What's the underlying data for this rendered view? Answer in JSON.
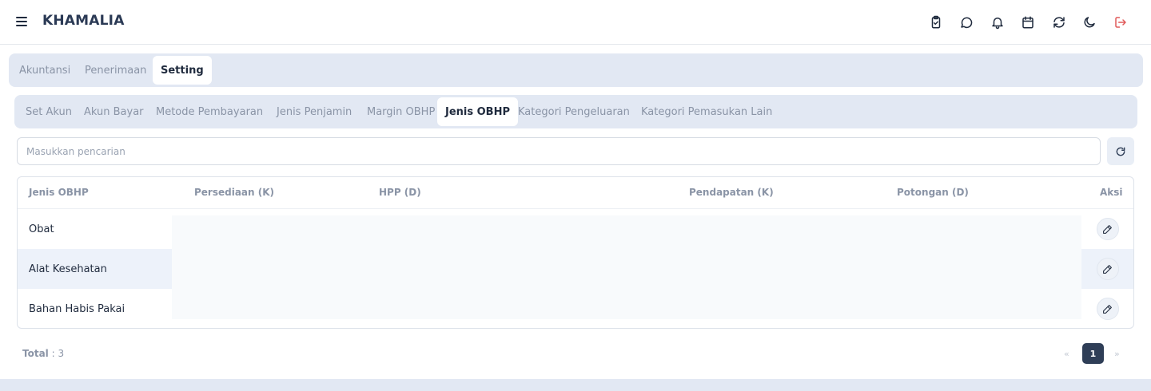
{
  "app": {
    "title": "KHAMALIA"
  },
  "header": {
    "icons": [
      "clipboard-check-icon",
      "chat-bubble-icon",
      "bell-icon",
      "calendar-icon",
      "sync-icon",
      "moon-icon",
      "logout-icon"
    ],
    "logout_color": "#e05a5a"
  },
  "main_tabs": [
    {
      "label": "Akuntansi",
      "active": false
    },
    {
      "label": "Penerimaan",
      "active": false
    },
    {
      "label": "Setting",
      "active": true
    }
  ],
  "sub_tabs": [
    {
      "label": "Set Akun",
      "active": false
    },
    {
      "label": "Akun Bayar",
      "active": false
    },
    {
      "label": "Metode Pembayaran",
      "active": false
    },
    {
      "label": "Jenis Penjamin",
      "active": false
    },
    {
      "label": "Margin OBHP",
      "active": false
    },
    {
      "label": "Jenis OBHP",
      "active": true
    },
    {
      "label": "Kategori Pengeluaran",
      "active": false
    },
    {
      "label": "Kategori Pemasukan Lain",
      "active": false
    }
  ],
  "search": {
    "placeholder": "Masukkan pencarian",
    "value": ""
  },
  "table": {
    "columns": [
      "Jenis OBHP",
      "Persediaan (K)",
      "HPP (D)",
      "Pendapatan (K)",
      "Potongan (D)",
      "Aksi"
    ],
    "rows": [
      {
        "name": "Obat"
      },
      {
        "name": "Alat Kesehatan"
      },
      {
        "name": "Bahan Habis Pakai"
      }
    ]
  },
  "footer": {
    "total_label": "Total",
    "total_value": " : 3",
    "pagination": {
      "prev": "«",
      "current": "1",
      "next": "»"
    }
  },
  "colors": {
    "accent": "#2f3e57",
    "tab_bg": "#e2e8f3",
    "row_highlight": "#edf2fa"
  }
}
